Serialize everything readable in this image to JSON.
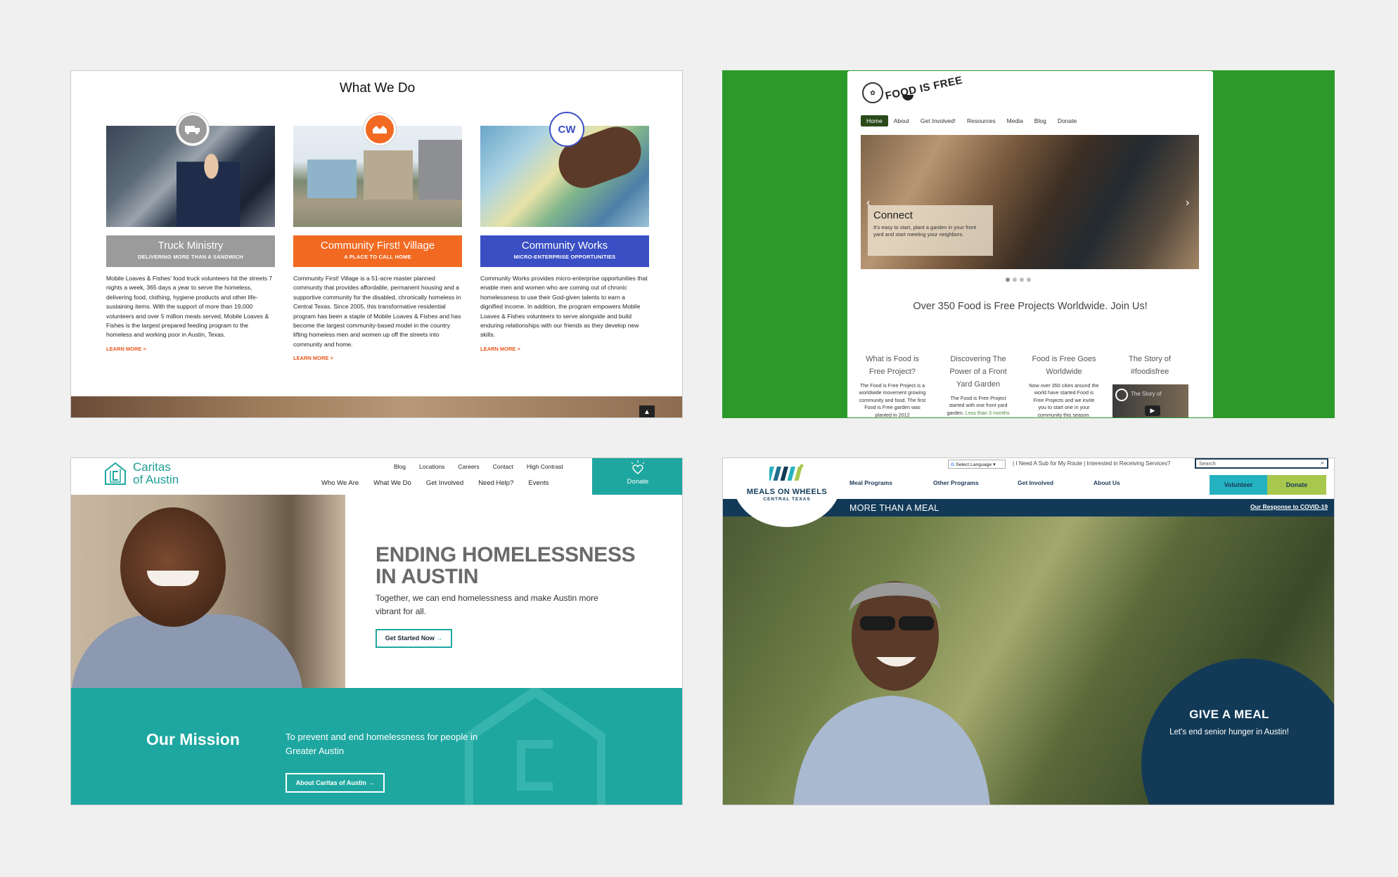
{
  "what_we_do": {
    "title": "What We Do",
    "columns": [
      {
        "title": "Truck Ministry",
        "subtitle": "DELIVERING MORE THAN A SANDWICH",
        "color": "#9b9b9b",
        "icon": "truck-icon",
        "body": "Mobile Loaves & Fishes' food truck volunteers hit the streets 7 nights a week, 365 days a year to serve the homeless, delivering food, clothing, hygiene products and other life-sustaining items. With the support of more than 19,000 volunteers and over 5 million meals served, Mobile Loaves & Fishes is the largest prepared feeding program to the homeless and working poor in Austin, Texas.",
        "link": "LEARN MORE >"
      },
      {
        "title": "Community First! Village",
        "subtitle": "A PLACE TO CALL HOME",
        "color": "#f26a22",
        "icon": "village-icon",
        "body": "Community First! Village is a 51-acre master planned community that provides affordable, permanent housing and a supportive community for the disabled, chronically homeless in Central Texas. Since 2005, this transformative residential program has been a staple of Mobile Loaves & Fishes and has become the largest community-based model in the country lifting homeless men and women up off the streets into community and home.",
        "link": "LEARN MORE >"
      },
      {
        "title": "Community Works",
        "subtitle": "MICRO-ENTERPRISE OPPORTUNITIES",
        "color": "#3a4fc4",
        "icon": "cw-icon",
        "body": "Community Works provides micro-enterprise opportunities that enable men and women who are coming out of chronic homelessness to use their God-given talents to earn a dignified income. In addition, the program empowers Mobile Loaves & Fishes volunteers to serve alongside and build enduring relationships with our friends as they develop new skills.",
        "link": "LEARN MORE >"
      }
    ],
    "badge_text": "CW"
  },
  "food_is_free": {
    "logo_text": "FOOD IS FREE",
    "nav": [
      "Home",
      "About",
      "Get Involved!",
      "Resources",
      "Media",
      "Blog",
      "Donate"
    ],
    "slide": {
      "heading": "Connect",
      "body": "It's easy to start, plant a garden in your front yard and start meeting your neighbors."
    },
    "join": "Over 350 Food is Free Projects Worldwide. Join Us!",
    "features": [
      {
        "title": "What is Food is Free Project?",
        "body": "The Food is Free Project is a worldwide movement growing community and food. The first Food is Free garden was planted in 2012"
      },
      {
        "title": "Discovering The Power of a Front Yard Garden",
        "body": "The Food is Free Project started with one front yard garden.",
        "link": "Less than 3 months"
      },
      {
        "title": "Food is Free Goes Worldwide",
        "body": "Now over 350 cities around the world have started Food is Free Projects and we invite you to start one in your community this season."
      },
      {
        "title": "The Story of #foodisfree",
        "video_title": "The Story of"
      }
    ]
  },
  "caritas": {
    "name_line1": "Caritas",
    "name_line2": "of Austin",
    "utility_nav": [
      "Blog",
      "Locations",
      "Careers",
      "Contact",
      "High Contrast"
    ],
    "main_nav": [
      "Who We Are",
      "What We Do",
      "Get Involved",
      "Need Help?",
      "Events"
    ],
    "donate": "Donate",
    "hero_title_line1": "ENDING HOMELESSNESS",
    "hero_title_line2": "IN AUSTIN",
    "hero_sub": "Together, we can end homelessness and make Austin more vibrant for all.",
    "cta": "Get Started Now",
    "mission_title": "Our Mission",
    "mission_text": "To prevent and end homelessness for people in Greater Austin",
    "about_btn": "About Caritas of Austin",
    "teal": "#1ea7a0"
  },
  "meals_on_wheels": {
    "language": "Select Language",
    "utility_links": "| I Need A Sub for My Route | Interested in Receiving Services?",
    "search_placeholder": "Search",
    "logo_line1": "MEALS ON WHEELS",
    "logo_line2": "CENTRAL TEXAS",
    "nav": [
      "Meal Programs",
      "Other Programs",
      "Get Involved",
      "About Us"
    ],
    "volunteer": "Volunteer",
    "donate": "Donate",
    "tagline": "MORE THAN A MEAL",
    "covid_link": "Our Response to COVID-19",
    "give_title": "GIVE A MEAL",
    "give_sub": "Let's end senior hunger in Austin!",
    "navy": "#123a57"
  }
}
